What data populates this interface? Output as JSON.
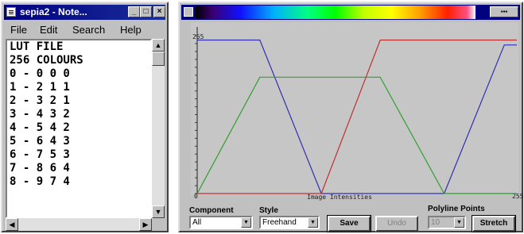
{
  "notepad": {
    "title": "sepia2 - Note...",
    "title_buttons": [
      "_",
      "□",
      "×"
    ],
    "menu": [
      "File",
      "Edit",
      "Search",
      "Help"
    ],
    "lines": [
      "LUT FILE",
      "256 COLOURS",
      "0 - 0 0 0",
      "1 - 2 1 1",
      "2 - 3 2 1",
      "3 - 4 3 2",
      "4 - 5 4 2",
      "5 - 6 4 3",
      "6 - 7 5 3",
      "7 - 8 6 4",
      "8 - 9 7 4"
    ],
    "icons": [
      "notepad-icon",
      "arrow-up-icon",
      "arrow-down-icon",
      "arrow-left-icon",
      "arrow-right-icon"
    ]
  },
  "lut_editor": {
    "title_buttons": "▪▪▪",
    "chart_data": {
      "type": "line",
      "x_label": "Image Intensities",
      "x_tick_labels": [
        "0",
        "255"
      ],
      "y_tick_labels": [
        "255"
      ],
      "ylim": [
        0,
        255
      ],
      "xlim": [
        0,
        255
      ],
      "series": [
        {
          "color": "#3030b0",
          "points": [
            [
              0,
              248
            ],
            [
              50,
              248
            ],
            [
              99,
              0
            ],
            [
              197,
              0
            ],
            [
              245,
              240
            ],
            [
              255,
              240
            ]
          ]
        },
        {
          "color": "#c03030",
          "points": [
            [
              0,
              0
            ],
            [
              99,
              0
            ],
            [
              146,
              248
            ],
            [
              255,
              248
            ]
          ]
        },
        {
          "color": "#30a030",
          "points": [
            [
              0,
              0
            ],
            [
              50,
              188
            ],
            [
              146,
              188
            ],
            [
              197,
              0
            ],
            [
              255,
              0
            ]
          ]
        }
      ],
      "grid": false
    },
    "controls": {
      "component_label": "Component",
      "component_value": "All",
      "style_label": "Style",
      "style_value": "Freehand",
      "save_label": "Save",
      "undo_label": "Undo",
      "polyline_label": "Polyline Points",
      "polyline_value": "10",
      "stretch_label": "Stretch"
    }
  }
}
